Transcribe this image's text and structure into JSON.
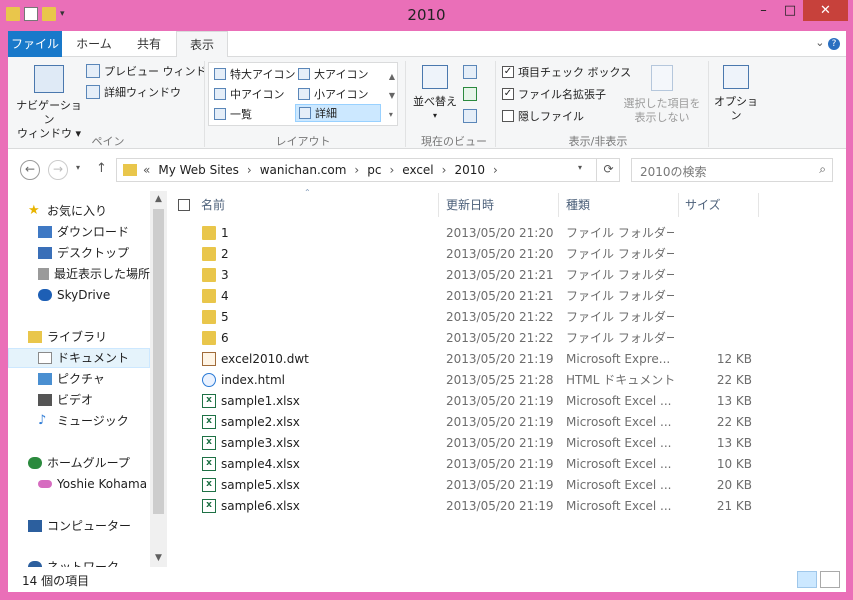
{
  "window": {
    "title": "2010",
    "min": "–",
    "max": "□",
    "close": "✕"
  },
  "ribbon_tabs": {
    "file": "ファイル",
    "home": "ホーム",
    "share": "共有",
    "view": "表示"
  },
  "ribbon": {
    "pane": {
      "nav_pane_1": "ナビゲーション",
      "nav_pane_2": "ウィンドウ ▾",
      "preview": "プレビュー ウィンドウ",
      "details": "詳細ウィンドウ",
      "label": "ペイン"
    },
    "layout": {
      "items": [
        "特大アイコン",
        "大アイコン",
        "中アイコン",
        "小アイコン",
        "一覧",
        "詳細"
      ],
      "label": "レイアウト"
    },
    "current_view": {
      "sort_1": "並べ替え",
      "label": "現在のビュー"
    },
    "show_hide": {
      "item_checkboxes": "項目チェック ボックス",
      "extensions": "ファイル名拡張子",
      "hidden": "隠しファイル",
      "hide_selected_1": "選択した項目を",
      "hide_selected_2": "表示しない",
      "label": "表示/非表示"
    },
    "options": "オプション"
  },
  "address": {
    "crumbs": [
      "«",
      "My Web Sites",
      "›",
      "wanichan.com",
      "›",
      "pc",
      "›",
      "excel",
      "›",
      "2010",
      "›"
    ],
    "search_placeholder": "2010の検索"
  },
  "nav": [
    {
      "label": "お気に入り",
      "color": "#e8b400"
    },
    {
      "label": "ダウンロード",
      "color": "#3f79c4"
    },
    {
      "label": "デスクトップ",
      "color": "#3a6fb8"
    },
    {
      "label": "最近表示した場所",
      "color": "#8a8a8a"
    },
    {
      "label": "SkyDrive",
      "color": "#1d5fb5"
    },
    {
      "label": "ライブラリ",
      "color": "#e9c64b"
    },
    {
      "label": "ドキュメント",
      "color": "#8a8a8a"
    },
    {
      "label": "ピクチャ",
      "color": "#4a8fd1"
    },
    {
      "label": "ビデオ",
      "color": "#555"
    },
    {
      "label": "ミュージック",
      "color": "#2f7cd6"
    },
    {
      "label": "ホームグループ",
      "color": "#2b8a3e"
    },
    {
      "label": "Yoshie Kohama",
      "color": "#d66cc0"
    },
    {
      "label": "コンピューター",
      "color": "#2c5f9e"
    },
    {
      "label": "ネットワーク",
      "color": "#2c5f9e"
    }
  ],
  "columns": {
    "name": "名前",
    "date": "更新日時",
    "type": "種類",
    "size": "サイズ"
  },
  "files": [
    {
      "name": "1",
      "date": "2013/05/20 21:20",
      "type": "ファイル フォルダー",
      "size": "",
      "kind": "folder"
    },
    {
      "name": "2",
      "date": "2013/05/20 21:20",
      "type": "ファイル フォルダー",
      "size": "",
      "kind": "folder"
    },
    {
      "name": "3",
      "date": "2013/05/20 21:21",
      "type": "ファイル フォルダー",
      "size": "",
      "kind": "folder"
    },
    {
      "name": "4",
      "date": "2013/05/20 21:21",
      "type": "ファイル フォルダー",
      "size": "",
      "kind": "folder"
    },
    {
      "name": "5",
      "date": "2013/05/20 21:22",
      "type": "ファイル フォルダー",
      "size": "",
      "kind": "folder"
    },
    {
      "name": "6",
      "date": "2013/05/20 21:22",
      "type": "ファイル フォルダー",
      "size": "",
      "kind": "folder"
    },
    {
      "name": "excel2010.dwt",
      "date": "2013/05/20 21:19",
      "type": "Microsoft Expre...",
      "size": "12 KB",
      "kind": "dwt"
    },
    {
      "name": "index.html",
      "date": "2013/05/25 21:28",
      "type": "HTML ドキュメント",
      "size": "22 KB",
      "kind": "html"
    },
    {
      "name": "sample1.xlsx",
      "date": "2013/05/20 21:19",
      "type": "Microsoft Excel ...",
      "size": "13 KB",
      "kind": "xls"
    },
    {
      "name": "sample2.xlsx",
      "date": "2013/05/20 21:19",
      "type": "Microsoft Excel ...",
      "size": "22 KB",
      "kind": "xls"
    },
    {
      "name": "sample3.xlsx",
      "date": "2013/05/20 21:19",
      "type": "Microsoft Excel ...",
      "size": "13 KB",
      "kind": "xls"
    },
    {
      "name": "sample4.xlsx",
      "date": "2013/05/20 21:19",
      "type": "Microsoft Excel ...",
      "size": "10 KB",
      "kind": "xls"
    },
    {
      "name": "sample5.xlsx",
      "date": "2013/05/20 21:19",
      "type": "Microsoft Excel ...",
      "size": "20 KB",
      "kind": "xls"
    },
    {
      "name": "sample6.xlsx",
      "date": "2013/05/20 21:19",
      "type": "Microsoft Excel ...",
      "size": "21 KB",
      "kind": "xls"
    }
  ],
  "status": {
    "count": "14 個の項目"
  }
}
